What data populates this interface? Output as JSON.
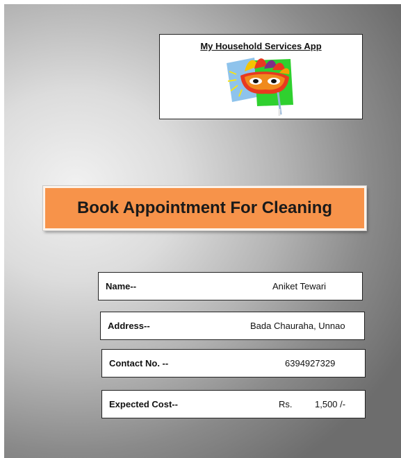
{
  "app": {
    "title": "My Household Services App",
    "logo_icon": "carnival-mask-icon"
  },
  "banner": {
    "title": "Book Appointment For Cleaning",
    "color": "#f7934a"
  },
  "fields": {
    "name": {
      "label": "Name--",
      "value": "Aniket Tewari"
    },
    "address": {
      "label": "Address--",
      "value": "Bada Chauraha, Unnao"
    },
    "contact": {
      "label": "Contact No. --",
      "value": "6394927329"
    },
    "cost": {
      "label": "Expected Cost--",
      "currency": "Rs.",
      "amount": "1,500 /-"
    }
  }
}
